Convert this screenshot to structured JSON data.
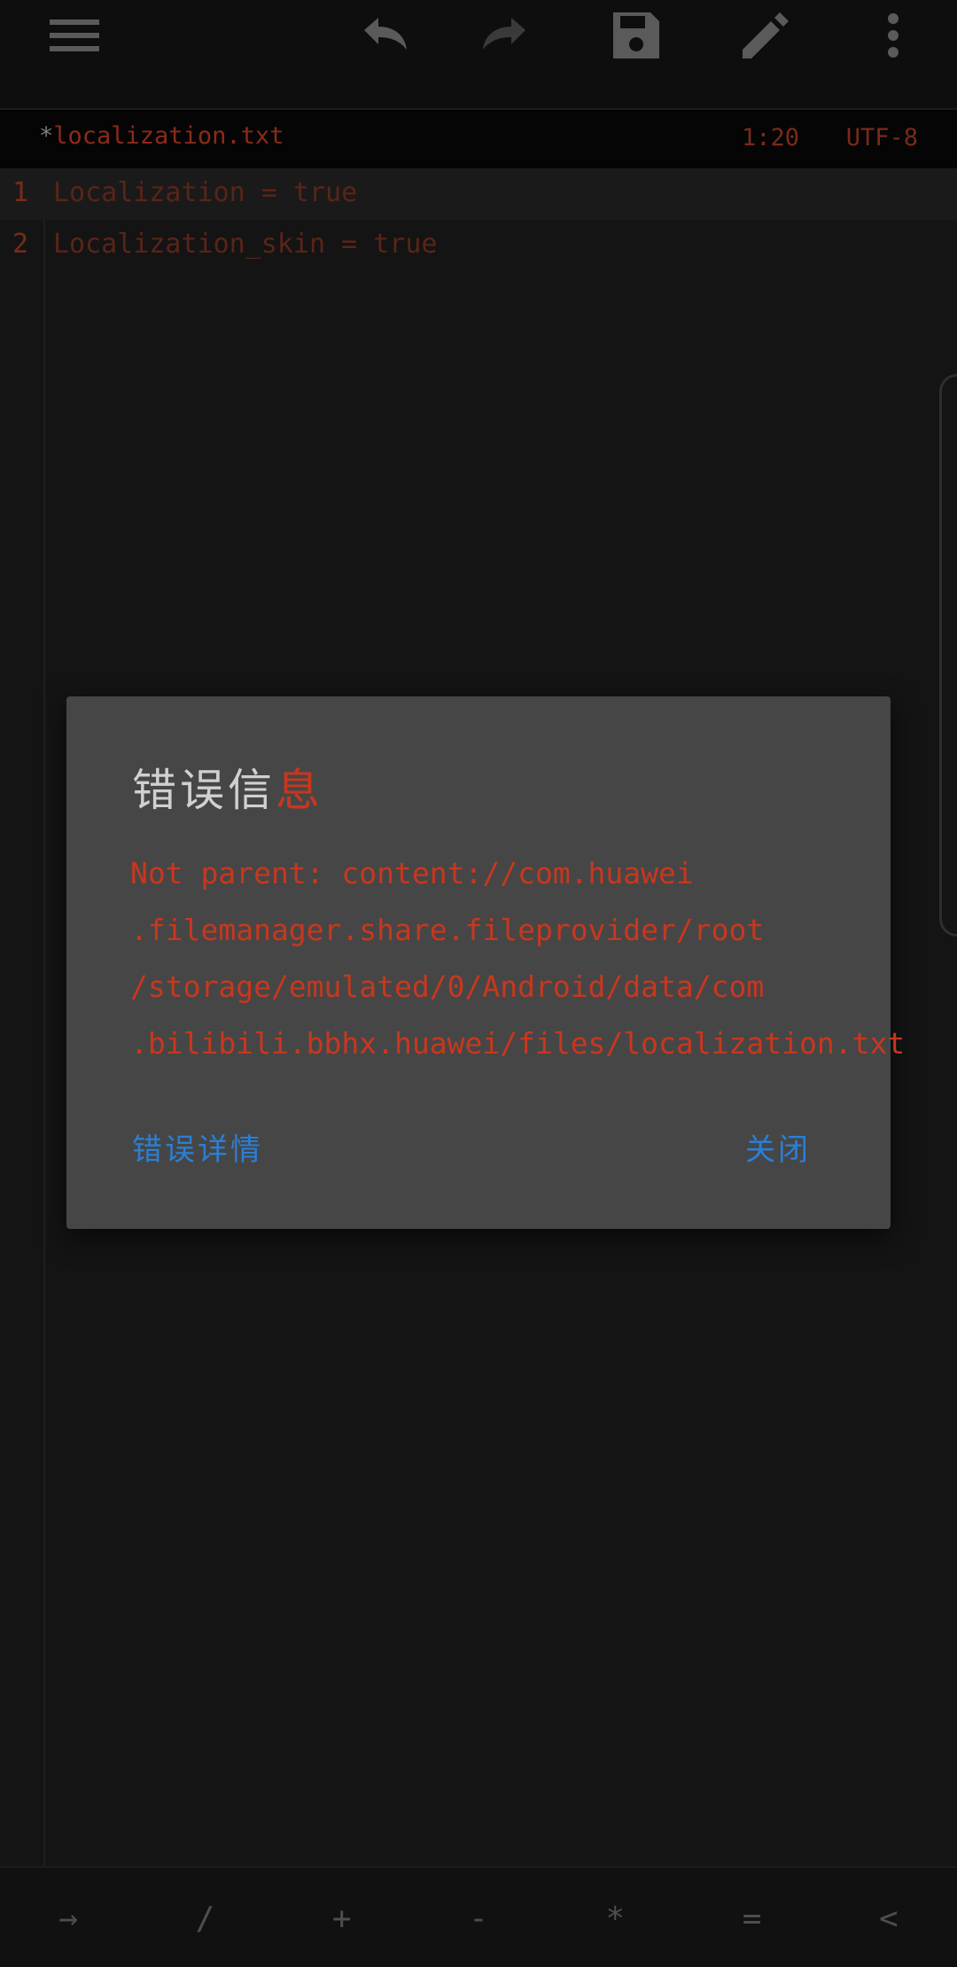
{
  "toolbar": {
    "menu_icon": "hamburger-menu-icon",
    "undo_icon": "undo-icon",
    "redo_icon": "redo-icon",
    "save_icon": "save-floppy-icon",
    "edit_icon": "pencil-icon",
    "more_icon": "more-vertical-icon"
  },
  "tab": {
    "modified_marker": "*",
    "file_name": "localization.txt",
    "cursor_position": "1:20",
    "encoding": "UTF-8"
  },
  "editor": {
    "lines": [
      {
        "number": "1",
        "text": "Localization = true"
      },
      {
        "number": "2",
        "text": "Localization_skin = true"
      }
    ]
  },
  "dialog": {
    "title_main": "错误信",
    "title_last": "息",
    "message_lines": [
      "Not parent: content://com.huawei",
      ".filemanager.share.fileprovider/root",
      "/storage/emulated/0/Android/data/com",
      ".bilibili.bbhx.huawei/files/localization.txt"
    ],
    "details_button": "错误详情",
    "close_button": "关闭"
  },
  "symbol_bar": {
    "keys": [
      "→",
      "/",
      "+",
      "-",
      "*",
      "=",
      "<"
    ]
  },
  "colors": {
    "accent_blue": "#2a7fd6",
    "error_red": "#c8371e",
    "dialog_bg": "#464646"
  }
}
